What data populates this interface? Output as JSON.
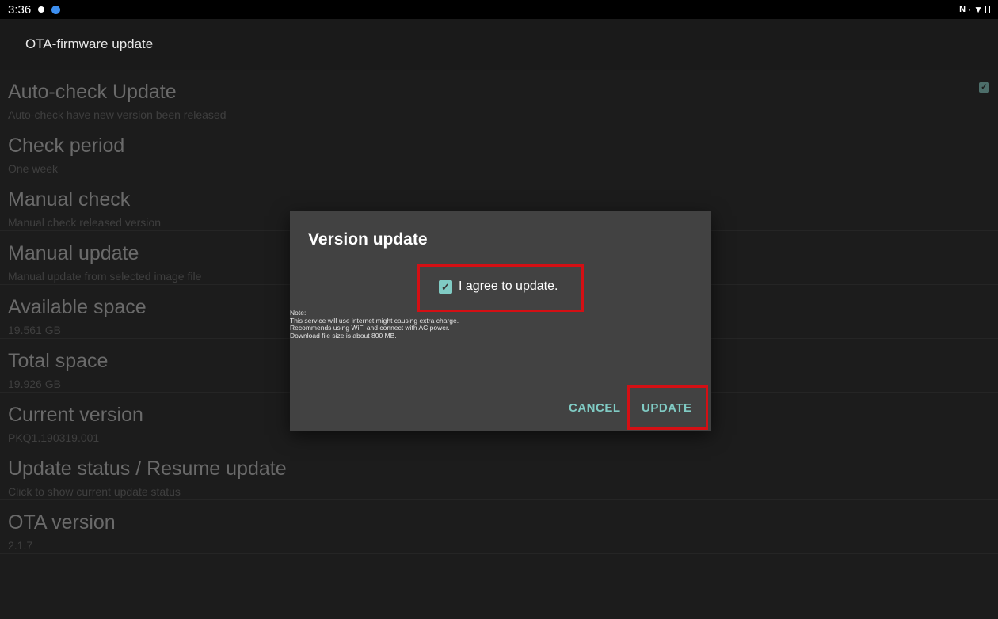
{
  "status_bar": {
    "time": "3:36",
    "right_icons": [
      "nfc-icon",
      "wifi-icon",
      "battery-icon"
    ]
  },
  "app_bar": {
    "title": "OTA-firmware update"
  },
  "preferences": [
    {
      "title": "Auto-check Update",
      "summary": "Auto-check have new version been released",
      "checked": true
    },
    {
      "title": "Check period",
      "summary": "One week"
    },
    {
      "title": "Manual check",
      "summary": "Manual check released version"
    },
    {
      "title": "Manual update",
      "summary": "Manual update from selected image file"
    },
    {
      "title": "Available space",
      "summary": "19.561 GB"
    },
    {
      "title": "Total space",
      "summary": "19.926 GB"
    },
    {
      "title": "Current version",
      "summary": "PKQ1.190319.001"
    },
    {
      "title": "Update status / Resume update",
      "summary": "Click to show current update status"
    },
    {
      "title": "OTA version",
      "summary": "2.1.7"
    }
  ],
  "dialog": {
    "title": "Version update",
    "agree_label": "I agree to update.",
    "agree_checked": true,
    "note_lines": [
      "Note:",
      "This service will use internet might causing extra charge.",
      "Recommends using WiFi and connect with AC power.",
      "Download file size is about 800 MB."
    ],
    "cancel_label": "CANCEL",
    "update_label": "UPDATE"
  },
  "colors": {
    "accent": "#80cbc4",
    "highlight": "#d40f14",
    "dialog_bg": "#424242",
    "background": "#1c1c1c"
  }
}
